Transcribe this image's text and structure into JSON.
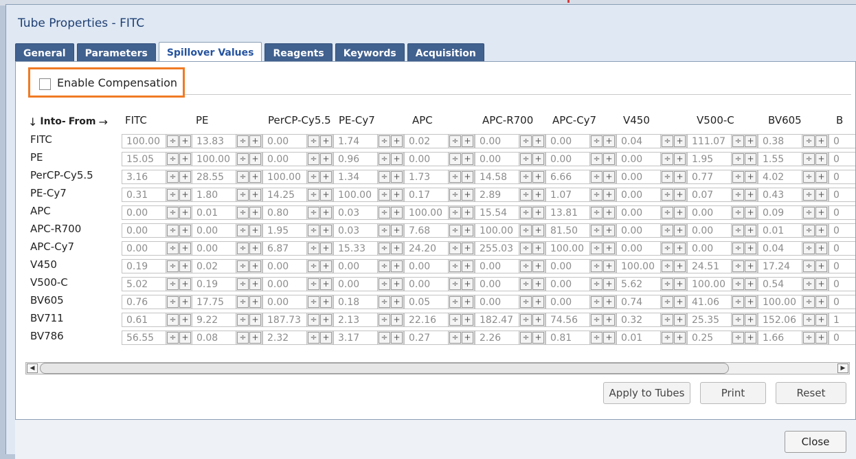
{
  "dialog": {
    "title": "Tube Properties - FITC"
  },
  "tabs": [
    {
      "label": "General",
      "active": false
    },
    {
      "label": "Parameters",
      "active": false
    },
    {
      "label": "Spillover Values",
      "active": true
    },
    {
      "label": "Reagents",
      "active": false
    },
    {
      "label": "Keywords",
      "active": false
    },
    {
      "label": "Acquisition",
      "active": false
    }
  ],
  "compensation": {
    "label": "Enable Compensation",
    "checked": false
  },
  "matrix": {
    "corner": {
      "into": "Into-",
      "from": "From"
    },
    "columns": [
      "FITC",
      "PE",
      "PerCP-Cy5.5",
      "PE-Cy7",
      "APC",
      "APC-R700",
      "APC-Cy7",
      "V450",
      "V500-C",
      "BV605",
      "B"
    ],
    "rows": [
      {
        "label": "FITC",
        "values": [
          "100.00",
          "13.83",
          "0.00",
          "1.74",
          "0.02",
          "0.00",
          "0.00",
          "0.04",
          "111.07",
          "0.38",
          "0"
        ]
      },
      {
        "label": "PE",
        "values": [
          "15.05",
          "100.00",
          "0.00",
          "0.96",
          "0.00",
          "0.00",
          "0.00",
          "0.00",
          "1.95",
          "1.55",
          "0"
        ]
      },
      {
        "label": "PerCP-Cy5.5",
        "values": [
          "3.16",
          "28.55",
          "100.00",
          "1.34",
          "1.73",
          "14.58",
          "6.66",
          "0.00",
          "0.77",
          "4.02",
          "0"
        ]
      },
      {
        "label": "PE-Cy7",
        "values": [
          "0.31",
          "1.80",
          "14.25",
          "100.00",
          "0.17",
          "2.89",
          "1.07",
          "0.00",
          "0.07",
          "0.43",
          "0"
        ]
      },
      {
        "label": "APC",
        "values": [
          "0.00",
          "0.01",
          "0.80",
          "0.03",
          "100.00",
          "15.54",
          "13.81",
          "0.00",
          "0.00",
          "0.09",
          "0"
        ]
      },
      {
        "label": "APC-R700",
        "values": [
          "0.00",
          "0.00",
          "1.95",
          "0.03",
          "7.68",
          "100.00",
          "81.50",
          "0.00",
          "0.00",
          "0.01",
          "0"
        ]
      },
      {
        "label": "APC-Cy7",
        "values": [
          "0.00",
          "0.00",
          "6.87",
          "15.33",
          "24.20",
          "255.03",
          "100.00",
          "0.00",
          "0.00",
          "0.04",
          "0"
        ]
      },
      {
        "label": "V450",
        "values": [
          "0.19",
          "0.02",
          "0.00",
          "0.00",
          "0.00",
          "0.00",
          "0.00",
          "100.00",
          "24.51",
          "17.24",
          "0"
        ]
      },
      {
        "label": "V500-C",
        "values": [
          "5.02",
          "0.19",
          "0.00",
          "0.00",
          "0.00",
          "0.00",
          "0.00",
          "5.62",
          "100.00",
          "0.54",
          "0"
        ]
      },
      {
        "label": "BV605",
        "values": [
          "0.76",
          "17.75",
          "0.00",
          "0.18",
          "0.05",
          "0.00",
          "0.00",
          "0.74",
          "41.06",
          "100.00",
          "0"
        ]
      },
      {
        "label": "BV711",
        "values": [
          "0.61",
          "9.22",
          "187.73",
          "2.13",
          "22.16",
          "182.47",
          "74.56",
          "0.32",
          "25.35",
          "152.06",
          "1"
        ]
      },
      {
        "label": "BV786",
        "values": [
          "56.55",
          "0.08",
          "2.32",
          "3.17",
          "0.27",
          "2.26",
          "0.81",
          "0.01",
          "0.25",
          "1.66",
          "0"
        ]
      }
    ]
  },
  "buttons": {
    "apply": "Apply to Tubes",
    "print": "Print",
    "reset": "Reset",
    "close": "Close"
  }
}
